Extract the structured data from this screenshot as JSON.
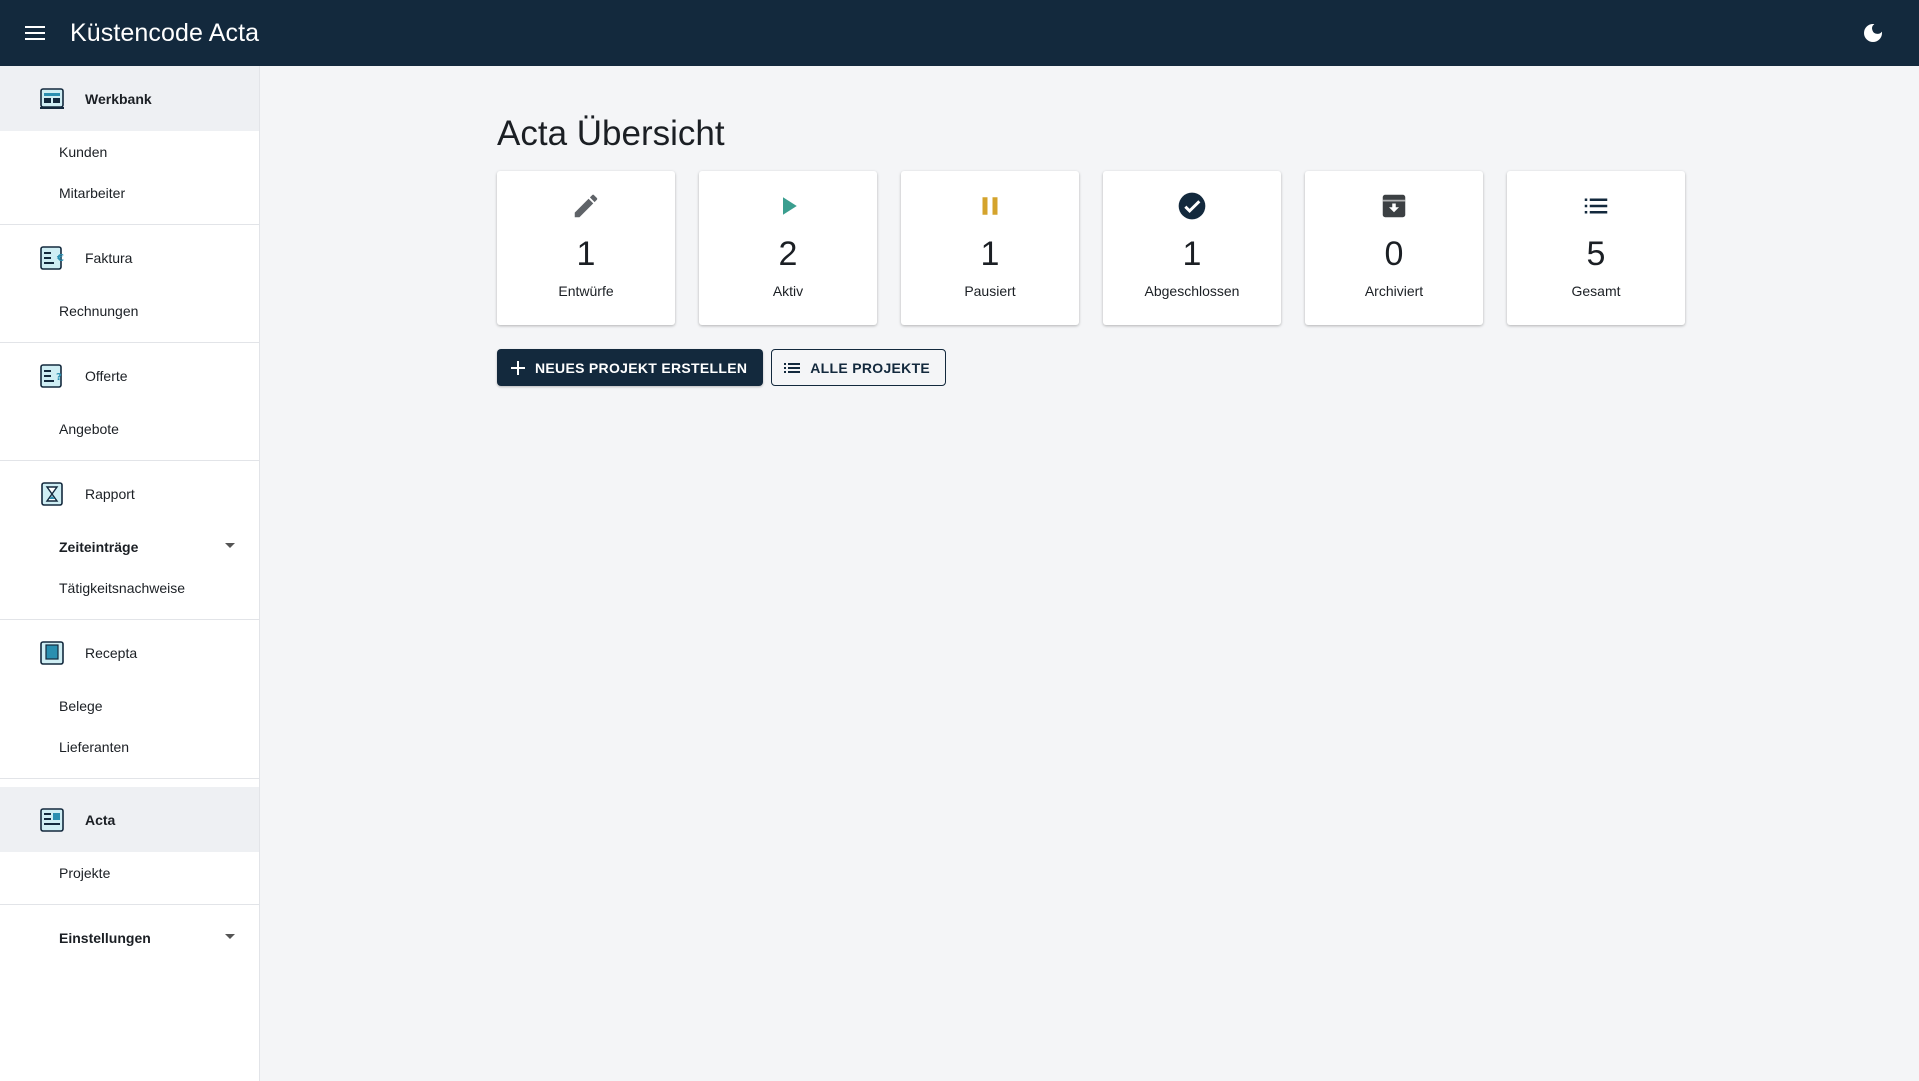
{
  "header": {
    "title": "Küstencode Acta",
    "menu_icon": "hamburger-menu-icon",
    "theme_icon": "moon-icon"
  },
  "sidebar": {
    "sections": [
      {
        "label": "Werkbank",
        "icon": "workbench-icon",
        "items": [
          "Kunden",
          "Mitarbeiter"
        ]
      },
      {
        "label": "Faktura",
        "icon": "invoice-icon",
        "items": [
          "Rechnungen"
        ]
      },
      {
        "label": "Offerte",
        "icon": "quote-icon",
        "items": [
          "Angebote"
        ]
      },
      {
        "label": "Rapport",
        "icon": "hourglass-icon",
        "items": [
          "Zeiteinträge",
          "Tätigkeitsnachweise"
        ]
      },
      {
        "label": "Recepta",
        "icon": "receipt-icon",
        "items": [
          "Belege",
          "Lieferanten"
        ]
      },
      {
        "label": "Acta",
        "icon": "project-icon",
        "items": [
          "Projekte"
        ]
      }
    ],
    "settings_label": "Einstellungen"
  },
  "main": {
    "title": "Acta Übersicht",
    "cards": [
      {
        "count": "1",
        "label": "Entwürfe",
        "icon": "pencil-icon",
        "color": "#5f6368"
      },
      {
        "count": "2",
        "label": "Aktiv",
        "icon": "play-icon",
        "color": "#3a9e8f"
      },
      {
        "count": "1",
        "label": "Pausiert",
        "icon": "pause-icon",
        "color": "#d4a32c"
      },
      {
        "count": "1",
        "label": "Abgeschlossen",
        "icon": "check-circle-icon",
        "color": "#13293d"
      },
      {
        "count": "0",
        "label": "Archiviert",
        "icon": "archive-icon",
        "color": "#3c4043"
      },
      {
        "count": "5",
        "label": "Gesamt",
        "icon": "list-icon",
        "color": "#13293d"
      }
    ],
    "actions": {
      "new_project": "NEUES PROJEKT ERSTELLEN",
      "all_projects": "ALLE PROJEKTE"
    }
  },
  "colors": {
    "header_bg": "#13293d",
    "page_bg": "#f4f5f7",
    "accent": "#3a9e8f"
  }
}
